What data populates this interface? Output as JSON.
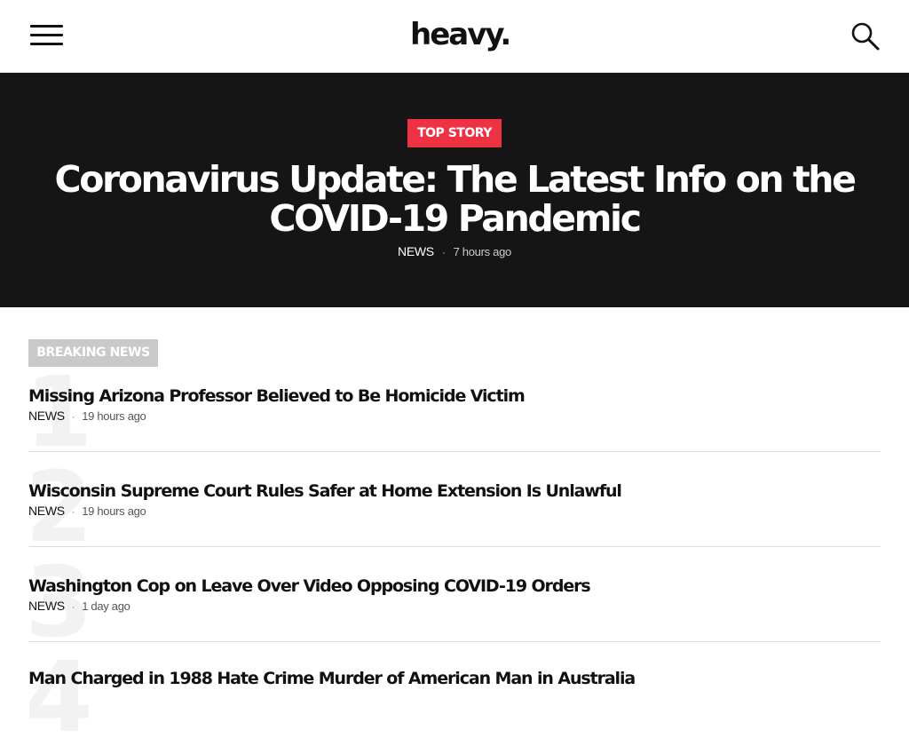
{
  "header": {
    "logo": "heavy.",
    "menu_icon": "hamburger-menu-icon",
    "search_icon": "search-icon"
  },
  "hero": {
    "badge": "TOP STORY",
    "title": "Coronavirus Update: The Latest Info on the COVID-19 Pandemic",
    "category": "NEWS",
    "separator": "·",
    "time": "7 hours ago"
  },
  "breaking": {
    "label": "BREAKING NEWS",
    "items": [
      {
        "rank": "1",
        "headline": "Missing Arizona Professor Believed to Be Homicide Victim",
        "category": "NEWS",
        "separator": "·",
        "time": "19 hours ago"
      },
      {
        "rank": "2",
        "headline": "Wisconsin Supreme Court Rules Safer at Home Extension Is Unlawful",
        "category": "NEWS",
        "separator": "·",
        "time": "19 hours ago"
      },
      {
        "rank": "3",
        "headline": "Washington Cop on Leave Over Video Opposing COVID-19 Orders",
        "category": "NEWS",
        "separator": "·",
        "time": "1 day ago"
      },
      {
        "rank": "4",
        "headline": "Man Charged in 1988 Hate Crime Murder of American Man in Australia",
        "category": "",
        "separator": "",
        "time": ""
      }
    ]
  },
  "colors": {
    "accent": "#ee3143",
    "hero_background": "#151515",
    "breaking_label_background": "#c9c9c9",
    "rank_number": "#f2f2f2",
    "text": "#111111"
  }
}
